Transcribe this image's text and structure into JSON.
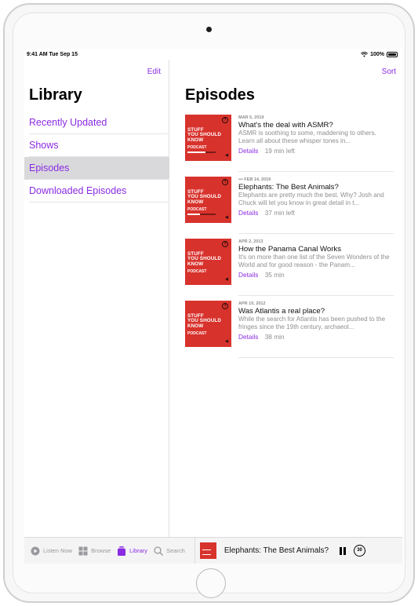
{
  "status_bar": {
    "time": "9:41 AM  Tue Sep 15",
    "battery": "100%"
  },
  "sidebar": {
    "edit_label": "Edit",
    "title": "Library",
    "items": [
      {
        "label": "Recently Updated"
      },
      {
        "label": "Shows"
      },
      {
        "label": "Episodes",
        "selected": true
      },
      {
        "label": "Downloaded Episodes"
      }
    ]
  },
  "main": {
    "sort_label": "Sort",
    "title": "Episodes",
    "artwork": {
      "line1": "STUFF",
      "line2": "YOU SHOULD",
      "line3": "KNOW",
      "podcast": "PODCAST"
    },
    "episodes": [
      {
        "date": "MAR 5, 2019",
        "title": "What's the deal with ASMR?",
        "description": "ASMR is soothing to some, maddening to others. Learn all about these whisper tones in...",
        "details": "Details",
        "duration": "19 min left",
        "progress": 0.65
      },
      {
        "date": "••• FEB 14, 2019",
        "title": "Elephants: The Best Animals?",
        "description": "Elephants are pretty much the best. Why? Josh and Chuck will let you know in great detail in t...",
        "details": "Details",
        "duration": "37 min left",
        "progress": 0.45
      },
      {
        "date": "APR 2, 2013",
        "title": "How the Panama Canal Works",
        "description": "It's on more than one list of the Seven Wonders of the World and for good reason - the Panam...",
        "details": "Details",
        "duration": "35 min",
        "progress": 0
      },
      {
        "date": "APR 10, 2012",
        "title": "Was Atlantis a real place?",
        "description": "While the search for Atlantis has been pushed to the fringes since the 19th century, archaeol...",
        "details": "Details",
        "duration": "38 min",
        "progress": 0
      }
    ]
  },
  "tab_bar": {
    "tabs": [
      {
        "label": "Listen Now",
        "icon": "play-circle-icon"
      },
      {
        "label": "Browse",
        "icon": "grid-icon"
      },
      {
        "label": "Library",
        "icon": "library-icon",
        "active": true
      },
      {
        "label": "Search",
        "icon": "search-icon"
      }
    ],
    "now_playing": {
      "title": "Elephants: The Best Animals?",
      "skip_label": "30"
    }
  },
  "colors": {
    "accent": "#8a2be2",
    "artwork": "#d8322c",
    "selected_row": "#d9d9db"
  }
}
